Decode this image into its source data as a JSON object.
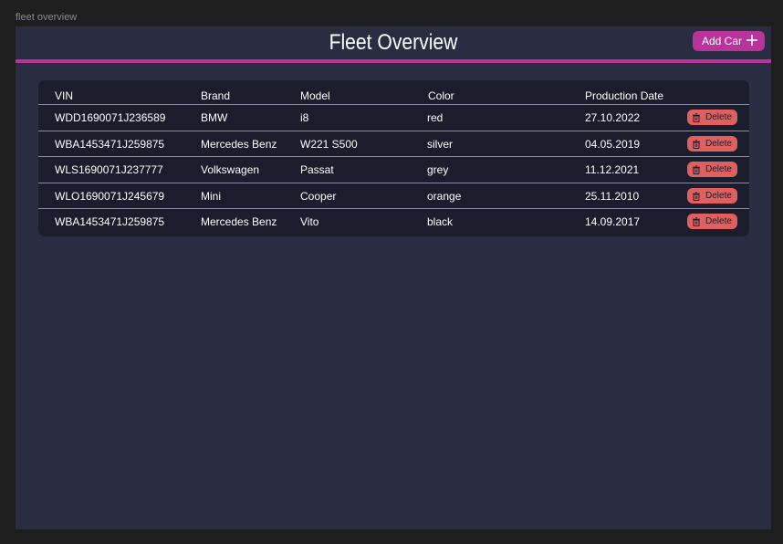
{
  "frame_label": "fleet overview",
  "header": {
    "title": "Fleet Overview",
    "add_button_label": "Add Car"
  },
  "table": {
    "columns": [
      "VIN",
      "Brand",
      "Model",
      "Color",
      "Production Date"
    ],
    "delete_label": "Delete",
    "rows": [
      {
        "vin": "WDD1690071J236589",
        "brand": "BMW",
        "model": "i8",
        "color": "red",
        "date": "27.10.2022"
      },
      {
        "vin": "WBA1453471J259875",
        "brand": "Mercedes Benz",
        "model": "W221 S500",
        "color": "silver",
        "date": "04.05.2019"
      },
      {
        "vin": "WLS1690071J237777",
        "brand": "Volkswagen",
        "model": "Passat",
        "color": "grey",
        "date": "11.12.2021"
      },
      {
        "vin": "WLO1690071J245679",
        "brand": "Mini",
        "model": "Cooper",
        "color": "orange",
        "date": "25.11.2010"
      },
      {
        "vin": "WBA1453471J259875",
        "brand": "Mercedes Benz",
        "model": "Vito",
        "color": "black",
        "date": "14.09.2017"
      }
    ]
  },
  "colors": {
    "accent": "#b8339a",
    "background": "#2a2d42",
    "table_background": "#1b1d2c",
    "delete": "#e06060"
  },
  "icons": {
    "add": "plus-icon",
    "delete": "trash-icon"
  }
}
